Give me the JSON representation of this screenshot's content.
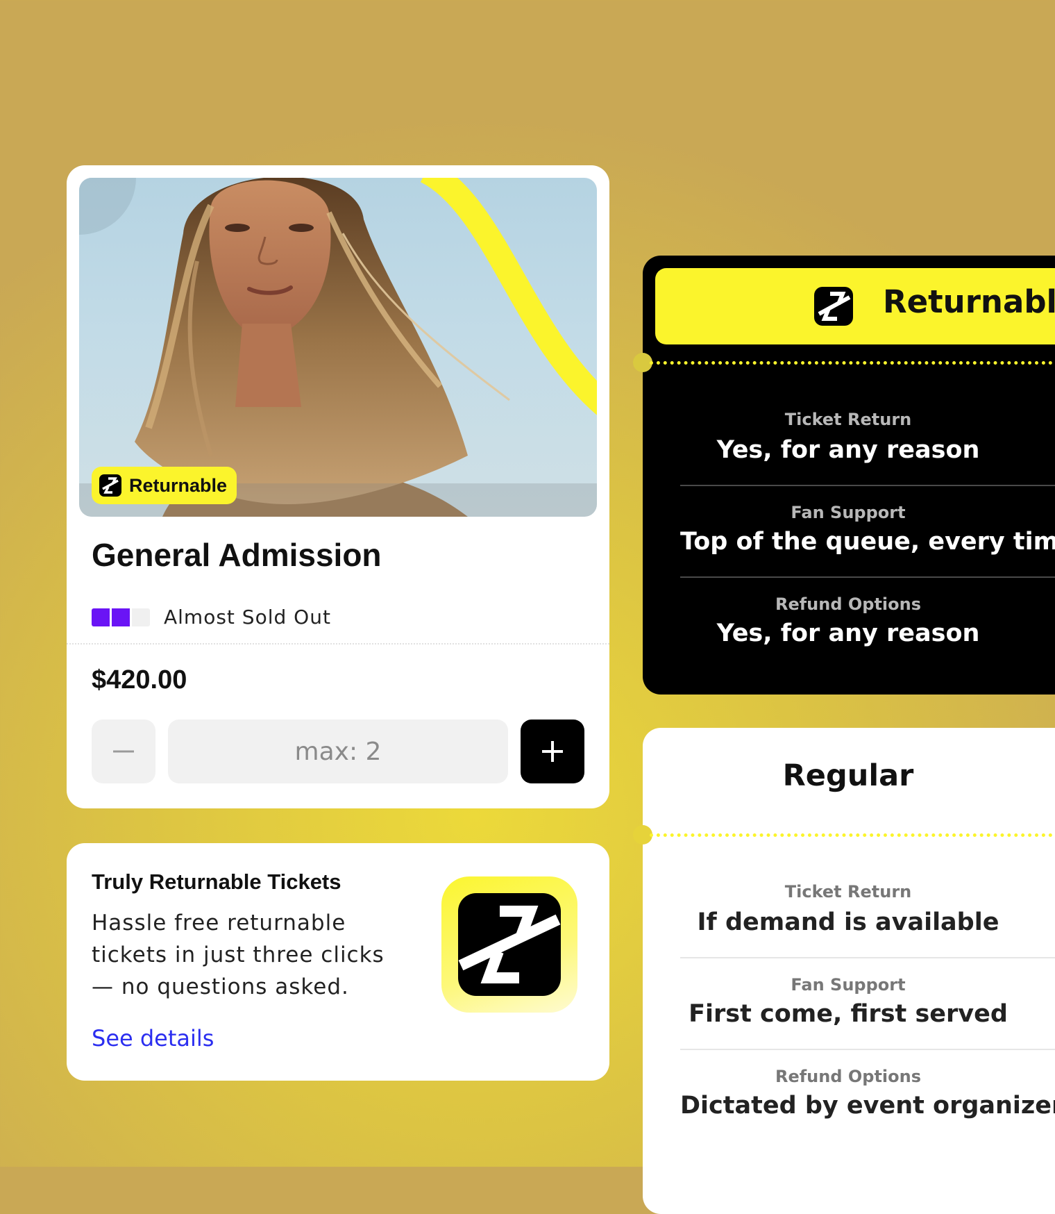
{
  "ticket": {
    "badge_label": "Returnable",
    "title": "General Admission",
    "availability": {
      "label": "Almost Sold Out",
      "filled": 2,
      "total": 3,
      "color": "#6a14f5"
    },
    "price": "$420.00",
    "stepper": {
      "placeholder": "max: 2",
      "minus_icon": "minus-icon",
      "plus_icon": "plus-icon"
    }
  },
  "info": {
    "title": "Truly Returnable Tickets",
    "description": "Hassle free returnable tickets in just three clicks— no questions asked.",
    "link_label": "See details",
    "link_color": "#2b2ef0",
    "icon": "return-arrows-icon"
  },
  "comparison": {
    "returnable": {
      "title": "Returnable",
      "rows": [
        {
          "label": "Ticket Return",
          "value": "Yes, for any reason"
        },
        {
          "label": "Fan Support",
          "value": "Top of the queue, every time"
        },
        {
          "label": "Refund Options",
          "value": "Yes, for any reason"
        }
      ]
    },
    "regular": {
      "title": "Regular",
      "rows": [
        {
          "label": "Ticket Return",
          "value": "If demand is available"
        },
        {
          "label": "Fan Support",
          "value": "First come, first served"
        },
        {
          "label": "Refund Options",
          "value": "Dictated by event organizer"
        }
      ]
    }
  },
  "colors": {
    "accent_yellow": "#fbf42c",
    "brand_purple": "#6a14f5",
    "dark": "#000000"
  }
}
